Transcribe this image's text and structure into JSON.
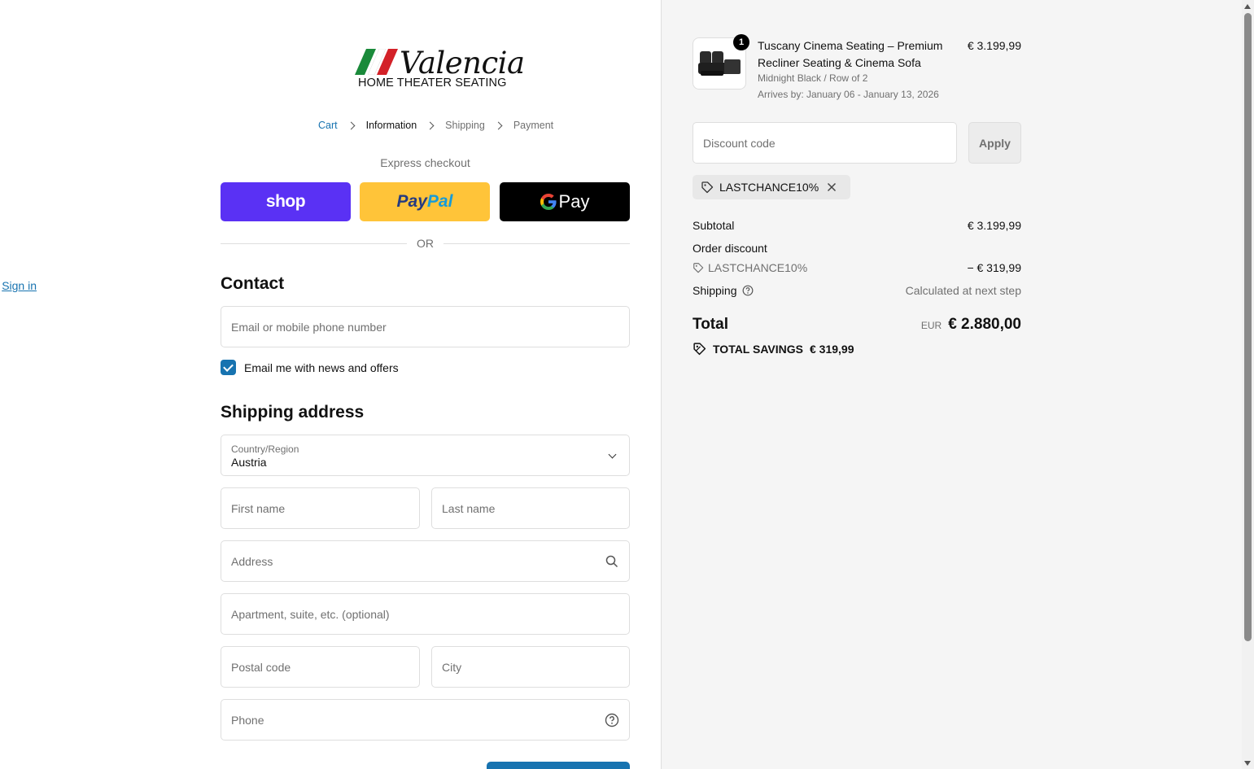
{
  "brand": {
    "name": "Valencia",
    "tagline": "HOME THEATER SEATING"
  },
  "breadcrumb": {
    "cart": "Cart",
    "information": "Information",
    "shipping": "Shipping",
    "payment": "Payment"
  },
  "express": {
    "label": "Express checkout",
    "shop": "shop",
    "paypal_a": "Pay",
    "paypal_b": "Pal",
    "gpay_g": "G",
    "gpay_text": "Pay",
    "or": "OR"
  },
  "contact": {
    "title": "Contact",
    "sign_in": "Sign in",
    "email_placeholder": "Email or mobile phone number",
    "newsletter_label": "Email me with news and offers",
    "newsletter_checked": true
  },
  "shipping": {
    "title": "Shipping address",
    "country_label": "Country/Region",
    "country_value": "Austria",
    "first_name": "First name",
    "last_name": "Last name",
    "address": "Address",
    "apartment": "Apartment, suite, etc. (optional)",
    "postal": "Postal code",
    "city": "City",
    "phone": "Phone"
  },
  "summary": {
    "product": {
      "qty": "1",
      "name": "Tuscany Cinema Seating – Premium Recliner Seating & Cinema Sofa",
      "variant": "Midnight Black / Row of 2",
      "arrives": "Arrives by: January 06 - January 13, 2026",
      "price": "€ 3.199,99"
    },
    "discount_placeholder": "Discount code",
    "apply": "Apply",
    "applied_code": "LASTCHANCE10%",
    "subtotal_label": "Subtotal",
    "subtotal": "€ 3.199,99",
    "order_discount_label": "Order discount",
    "discount_code": "LASTCHANCE10%",
    "discount_amount": "− € 319,99",
    "shipping_label": "Shipping",
    "shipping_value": "Calculated at next step",
    "total_label": "Total",
    "currency": "EUR",
    "total": "€ 2.880,00",
    "savings_label": "TOTAL SAVINGS",
    "savings": "€ 319,99"
  },
  "colors": {
    "accent": "#1773b0",
    "shop": "#5a31f4",
    "paypal": "#ffc439"
  }
}
